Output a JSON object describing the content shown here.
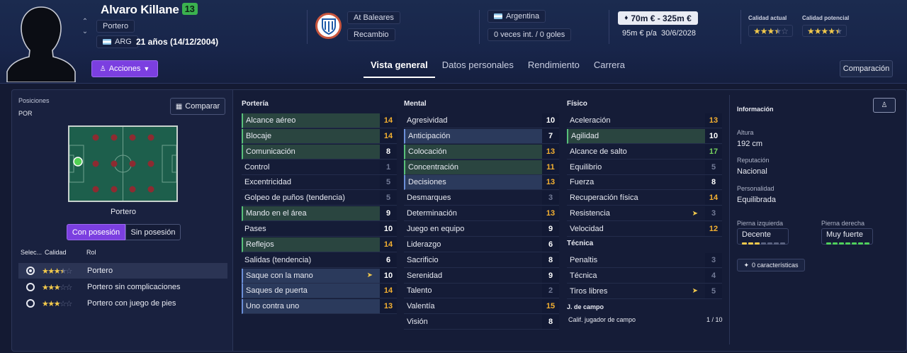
{
  "header": {
    "player_name": "Alvaro Killane",
    "ca": "13",
    "position": "Portero",
    "nation_code": "ARG",
    "age": "21 años (14/12/2004)",
    "club": "At Baleares",
    "squad_status": "Recambio",
    "nationality": "Argentina",
    "international": "0 veces int. / 0 goles",
    "value": "70m € - 325m €",
    "wage": "95m € p/a",
    "contract_end": "30/6/2028",
    "current_ability_label": "Calidad actual",
    "potential_ability_label": "Calidad potencial",
    "current_stars": 3.5,
    "potential_stars": 4.5,
    "acciones_label": "Acciones",
    "comparacion_label": "Comparación",
    "colors": {
      "accent": "#7b3fe0",
      "ca_badge": "#3bb24f"
    }
  },
  "tabs": [
    {
      "label": "Vista general",
      "active": true
    },
    {
      "label": "Datos personales",
      "active": false
    },
    {
      "label": "Rendimiento",
      "active": false
    },
    {
      "label": "Carrera",
      "active": false
    }
  ],
  "left": {
    "positions_label": "Posiciones",
    "positions_value": "POR",
    "compare_label": "Comparar",
    "pitch_position_label": "Portero",
    "seg_on": "Con posesión",
    "seg_off": "Sin posesión",
    "col_select": "Selec...",
    "col_quality": "Calidad",
    "col_role": "Rol",
    "roles": [
      {
        "name": "Portero",
        "stars": 3.5,
        "selected": true
      },
      {
        "name": "Portero sin complicaciones",
        "stars": 3,
        "selected": false
      },
      {
        "name": "Portero con juego de pies",
        "stars": 3,
        "selected": false
      }
    ]
  },
  "porteria": {
    "title": "Portería",
    "attrs": [
      {
        "name": "Alcance aéreo",
        "value": "14",
        "hl": "g"
      },
      {
        "name": "Blocaje",
        "value": "14",
        "hl": "g"
      },
      {
        "name": "Comunicación",
        "value": "8",
        "hl": "g"
      },
      {
        "name": "Control",
        "value": "1",
        "hl": ""
      },
      {
        "name": "Excentricidad",
        "value": "5",
        "hl": ""
      },
      {
        "name": "Golpeo de puños (tendencia)",
        "value": "5",
        "hl": ""
      },
      {
        "name": "Mando en el área",
        "value": "9",
        "hl": "g"
      },
      {
        "name": "Pases",
        "value": "10",
        "hl": ""
      },
      {
        "name": "Reflejos",
        "value": "14",
        "hl": "g"
      },
      {
        "name": "Salidas (tendencia)",
        "value": "6",
        "hl": ""
      },
      {
        "name": "Saque con la mano",
        "value": "10",
        "hl": "b",
        "arrow": true
      },
      {
        "name": "Saques de puerta",
        "value": "14",
        "hl": "b"
      },
      {
        "name": "Uno contra uno",
        "value": "13",
        "hl": "b"
      }
    ]
  },
  "mental": {
    "title": "Mental",
    "attrs": [
      {
        "name": "Agresividad",
        "value": "10",
        "hl": ""
      },
      {
        "name": "Anticipación",
        "value": "7",
        "hl": "b"
      },
      {
        "name": "Colocación",
        "value": "13",
        "hl": "g"
      },
      {
        "name": "Concentración",
        "value": "11",
        "hl": "g"
      },
      {
        "name": "Decisiones",
        "value": "13",
        "hl": "b"
      },
      {
        "name": "Desmarques",
        "value": "3",
        "hl": ""
      },
      {
        "name": "Determinación",
        "value": "13",
        "hl": ""
      },
      {
        "name": "Juego en equipo",
        "value": "9",
        "hl": ""
      },
      {
        "name": "Liderazgo",
        "value": "6",
        "hl": ""
      },
      {
        "name": "Sacrificio",
        "value": "8",
        "hl": ""
      },
      {
        "name": "Serenidad",
        "value": "9",
        "hl": ""
      },
      {
        "name": "Talento",
        "value": "2",
        "hl": ""
      },
      {
        "name": "Valentía",
        "value": "15",
        "hl": ""
      },
      {
        "name": "Visión",
        "value": "8",
        "hl": ""
      }
    ]
  },
  "fisico": {
    "title": "Físico",
    "attrs": [
      {
        "name": "Aceleración",
        "value": "13",
        "hl": ""
      },
      {
        "name": "Agilidad",
        "value": "10",
        "hl": "g"
      },
      {
        "name": "Alcance de salto",
        "value": "17",
        "hl": ""
      },
      {
        "name": "Equilibrio",
        "value": "5",
        "hl": ""
      },
      {
        "name": "Fuerza",
        "value": "8",
        "hl": ""
      },
      {
        "name": "Recuperación física",
        "value": "14",
        "hl": ""
      },
      {
        "name": "Resistencia",
        "value": "3",
        "hl": "",
        "arrow": true
      },
      {
        "name": "Velocidad",
        "value": "12",
        "hl": ""
      }
    ]
  },
  "tecnica": {
    "title": "Técnica",
    "attrs": [
      {
        "name": "Penaltis",
        "value": "3",
        "hl": ""
      },
      {
        "name": "Técnica",
        "value": "4",
        "hl": ""
      },
      {
        "name": "Tiros libres",
        "value": "5",
        "hl": "",
        "arrow": true
      }
    ]
  },
  "campo": {
    "title": "J. de campo",
    "rating_label": "Calif. jugador de campo",
    "rating_value": "1 / 10"
  },
  "info": {
    "title": "Información",
    "height_label": "Altura",
    "height_value": "192 cm",
    "reputation_label": "Reputación",
    "reputation_value": "Nacional",
    "personality_label": "Personalidad",
    "personality_value": "Equilibrada",
    "left_foot_label": "Pierna izquierda",
    "left_foot_value": "Decente",
    "right_foot_label": "Pierna derecha",
    "right_foot_value": "Muy fuerte",
    "traits_label": "0 características"
  }
}
